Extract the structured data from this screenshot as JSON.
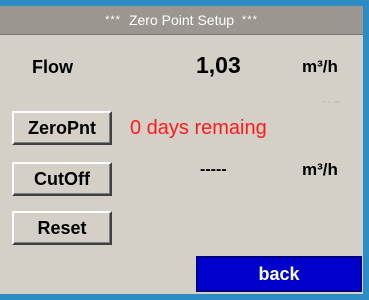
{
  "header": {
    "title": "Zero Point Setup",
    "deco_left": "***",
    "deco_right": "***"
  },
  "flow": {
    "label": "Flow",
    "value": "1,03",
    "unit": "m³/h"
  },
  "zeropnt": {
    "button_label": "ZeroPnt",
    "status": "0 days remaing"
  },
  "cutoff": {
    "button_label": "CutOff",
    "value": "-----",
    "unit": "m³/h"
  },
  "reset": {
    "button_label": "Reset"
  },
  "back": {
    "label": "back"
  },
  "colors": {
    "frame": "#2d8cc4",
    "title_bar": "#9b9790",
    "status_text": "#ff1a1a",
    "back_button": "#0000cc",
    "panel": "#d4d0c8"
  }
}
